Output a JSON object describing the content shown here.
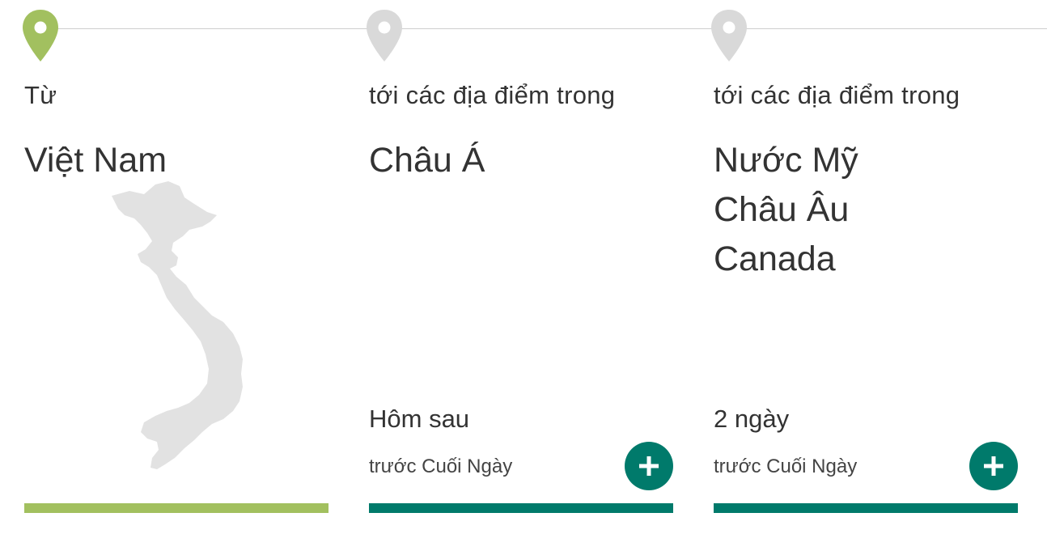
{
  "colors": {
    "origin_accent": "#a2c05f",
    "destination_accent": "#007a6b",
    "pin_inactive": "#d9d9d9",
    "timeline": "#cfcfcf",
    "map_fill": "#e2e2e2"
  },
  "origin": {
    "label": "Từ",
    "country": "Việt Nam",
    "pin_icon": "map-pin-icon",
    "map_icon": "vietnam-map"
  },
  "destinations": [
    {
      "label": "tới các địa điểm trong",
      "places": [
        "Châu Á"
      ],
      "delivery": "Hôm sau",
      "deadline": "trước Cuối Ngày",
      "pin_icon": "map-pin-icon",
      "action_icon": "plus-icon"
    },
    {
      "label": "tới các địa điểm trong",
      "places": [
        "Nước Mỹ",
        "Châu Âu",
        "Canada"
      ],
      "delivery": "2 ngày",
      "deadline": "trước Cuối Ngày",
      "pin_icon": "map-pin-icon",
      "action_icon": "plus-icon"
    }
  ]
}
